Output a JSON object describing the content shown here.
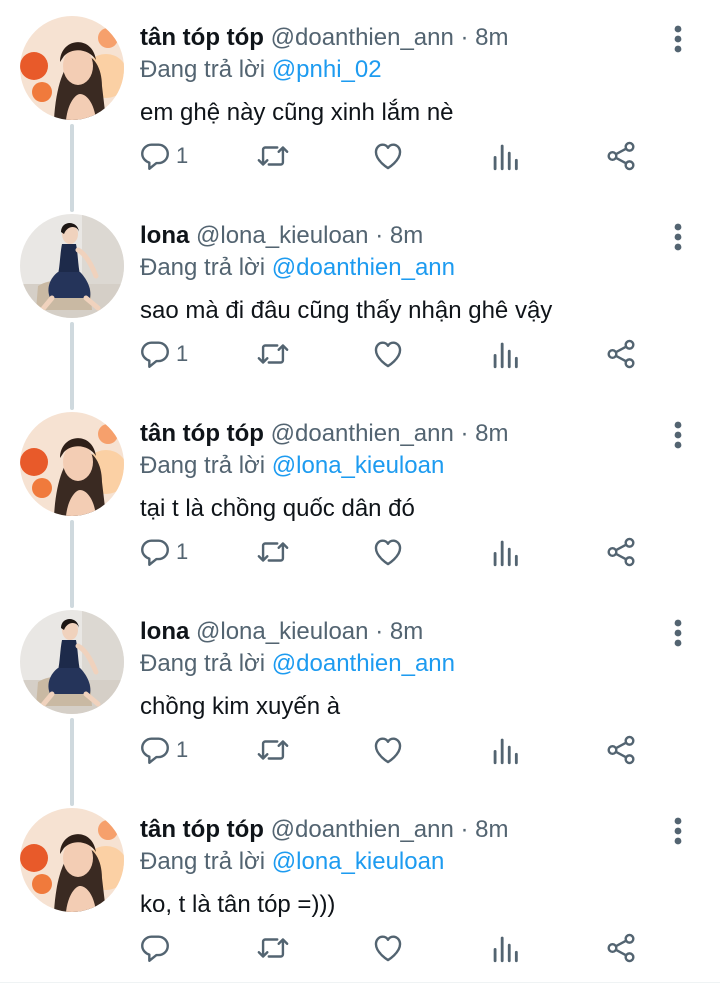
{
  "replying_prefix": "Đang trả lời",
  "tweets": [
    {
      "name": "tân tóp tóp",
      "handle": "@doanthien_ann",
      "sep": "·",
      "time": "8m",
      "replying_to": "@pnhi_02",
      "text": "em ghệ này cũng xinh lắm nè",
      "reply_count": "1",
      "avatar": "flower-portrait"
    },
    {
      "name": "lona",
      "handle": "@lona_kieuloan",
      "sep": "·",
      "time": "8m",
      "replying_to": "@doanthien_ann",
      "text": "sao mà đi đâu cũng thấy nhận ghê vậy",
      "reply_count": "1",
      "avatar": "seated-dress"
    },
    {
      "name": "tân tóp tóp",
      "handle": "@doanthien_ann",
      "sep": "·",
      "time": "8m",
      "replying_to": "@lona_kieuloan",
      "text": "tại t là chồng quốc dân đó",
      "reply_count": "1",
      "avatar": "flower-portrait"
    },
    {
      "name": "lona",
      "handle": "@lona_kieuloan",
      "sep": "·",
      "time": "8m",
      "replying_to": "@doanthien_ann",
      "text": "chồng kim xuyến à",
      "reply_count": "1",
      "avatar": "seated-dress"
    },
    {
      "name": "tân tóp tóp",
      "handle": "@doanthien_ann",
      "sep": "·",
      "time": "8m",
      "replying_to": "@lona_kieuloan",
      "text": "ko, t là tân tóp =)))",
      "reply_count": "",
      "avatar": "flower-portrait"
    }
  ],
  "icons": {
    "more": "more-vertical-icon",
    "reply": "reply-bubble-icon",
    "retweet": "retweet-icon",
    "like": "heart-icon",
    "views": "views-chart-icon",
    "share": "share-icon"
  },
  "colors": {
    "name": "#0f1419",
    "secondary": "#536471",
    "mention": "#1d9bf0",
    "thread_line": "#cfd9de"
  }
}
